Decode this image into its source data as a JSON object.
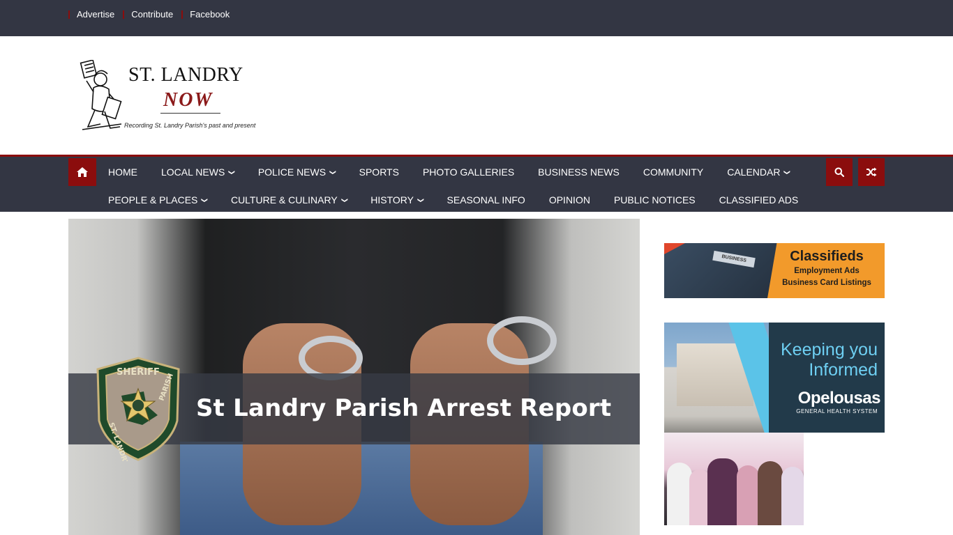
{
  "topbar": {
    "links": [
      "Advertise",
      "Contribute",
      "Facebook"
    ]
  },
  "logo": {
    "title": "ST. LANDRY",
    "now": "NOW",
    "tagline": "Recording St. Landry Parish's past and present"
  },
  "nav": {
    "home_icon": "home-icon",
    "row1": [
      "HOME",
      "LOCAL NEWS",
      "POLICE NEWS",
      "SPORTS",
      "PHOTO GALLERIES",
      "BUSINESS NEWS",
      "COMMUNITY",
      "CALENDAR"
    ],
    "row2": [
      "PEOPLE & PLACES",
      "CULTURE & CULINARY",
      "HISTORY",
      "SEASONAL INFO",
      "OPINION",
      "PUBLIC NOTICES",
      "CLASSIFIED ADS"
    ],
    "dropdown_items": [
      "LOCAL NEWS",
      "POLICE NEWS",
      "CALENDAR",
      "PEOPLE & PLACES",
      "CULTURE & CULINARY",
      "HISTORY"
    ],
    "search_icon": "search-icon",
    "random_icon": "shuffle-icon"
  },
  "hero": {
    "title": "St Landry Parish Arrest Report",
    "badge_top": "SHERIFF",
    "badge_left": "ST. LANDRY",
    "badge_right": "PARISH"
  },
  "sidebar": {
    "classifieds": {
      "title": "Classifieds",
      "line1": "Employment Ads",
      "line2": "Business Card Listings",
      "paper_label": "BUSINESS"
    },
    "hospital": {
      "tagline_1": "Keeping you",
      "tagline_2": "Informed",
      "brand": "Opelousas",
      "sub": "GENERAL HEALTH SYSTEM"
    }
  },
  "colors": {
    "bar": "#333643",
    "accent": "#8b0d0d",
    "classifieds_orange": "#f29a2b",
    "hospital_blue": "#6ecff2"
  }
}
